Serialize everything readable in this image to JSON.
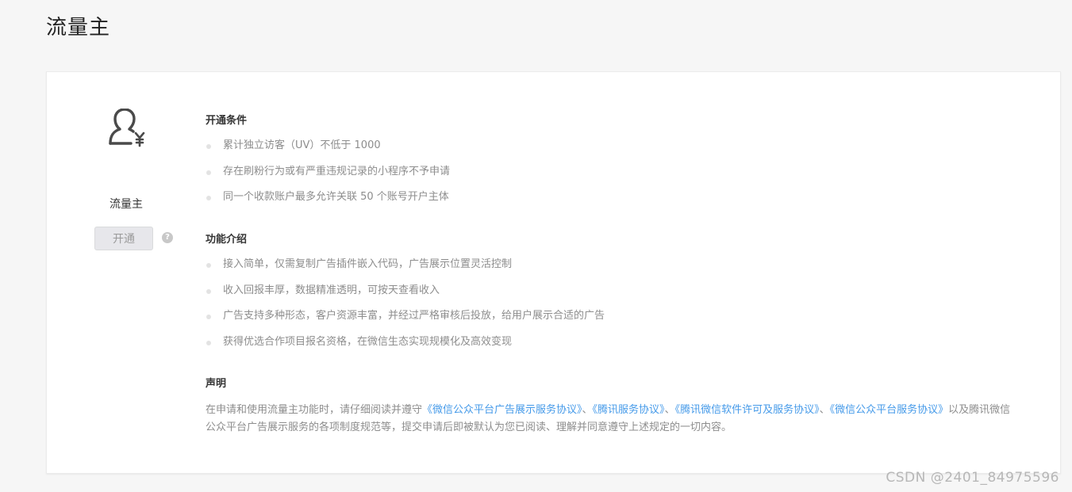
{
  "page": {
    "title": "流量主"
  },
  "left": {
    "icon": "user-yen-icon",
    "label": "流量主",
    "open_button": "开通",
    "help_icon": "question-icon",
    "help_glyph": "?"
  },
  "sections": {
    "conditions": {
      "title": "开通条件",
      "items": [
        "累计独立访客（UV）不低于 1000",
        "存在刷粉行为或有严重违规记录的小程序不予申请",
        "同一个收款账户最多允许关联 50 个账号开户主体"
      ]
    },
    "features": {
      "title": "功能介绍",
      "items": [
        "接入简单，仅需复制广告插件嵌入代码，广告展示位置灵活控制",
        "收入回报丰厚，数据精准透明，可按天查看收入",
        "广告支持多种形态，客户资源丰富，并经过严格审核后投放，给用户展示合适的广告",
        "获得优选合作项目报名资格，在微信生态实现规模化及高效变现"
      ]
    },
    "declaration": {
      "title": "声明",
      "text_before": "在申请和使用流量主功能时，请仔细阅读并遵守",
      "link1": "《微信公众平台广告展示服务协议》",
      "sep1": "、",
      "link2": "《腾讯服务协议》",
      "sep2": "、",
      "link3": "《腾讯微信软件许可及服务协议》",
      "sep3": "、",
      "link4": "《微信公众平台服务协议》",
      "text_after": "以及腾讯微信公众平台广告展示服务的各项制度规范等，提交申请后即被默认为您已阅读、理解并同意遵守上述规定的一切内容。"
    }
  },
  "watermark": "CSDN @2401_84975596",
  "colors": {
    "link": "#459ae9",
    "text_muted": "#8d8d8d",
    "bullet": "#e3e3e3"
  }
}
